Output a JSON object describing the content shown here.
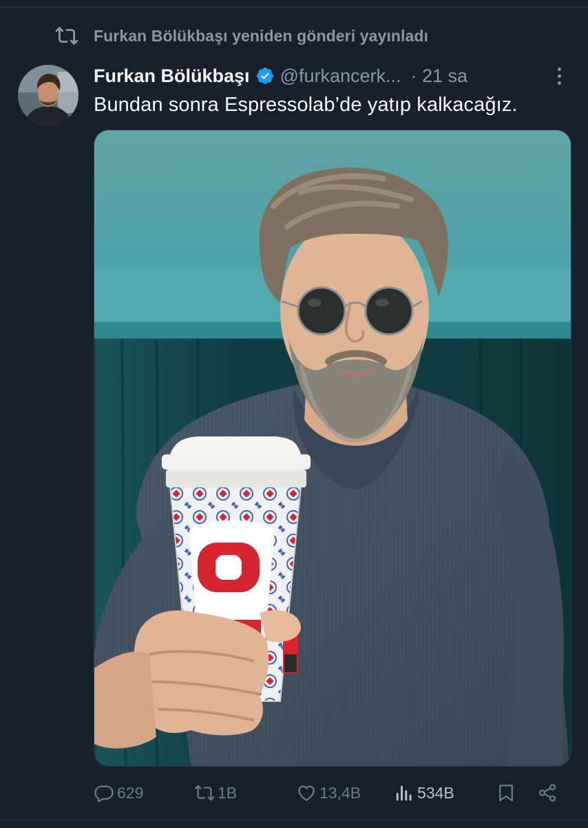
{
  "repost": {
    "icon": "repost-icon",
    "text": "Furkan Bölükbaşı yeniden gönderi yayınladı"
  },
  "tweet": {
    "author_name": "Furkan Bölükbaşı",
    "verified_icon": "verified-badge-icon",
    "handle": "@furkancerk...",
    "time": "· 21 sa",
    "text": "Bundan sonra Espressolab’de yatıp kalkacağız.",
    "more_icon": "more-options-icon"
  },
  "actions": {
    "replies": "629",
    "reposts": "1B",
    "likes": "13,4B",
    "views": "534B",
    "bookmark_icon": "bookmark-icon",
    "share_icon": "share-icon"
  },
  "colors": {
    "background": "#15202b",
    "secondary_text": "#8b98a5",
    "verified": "#1d9bf0",
    "cup_red": "#d7242f"
  }
}
